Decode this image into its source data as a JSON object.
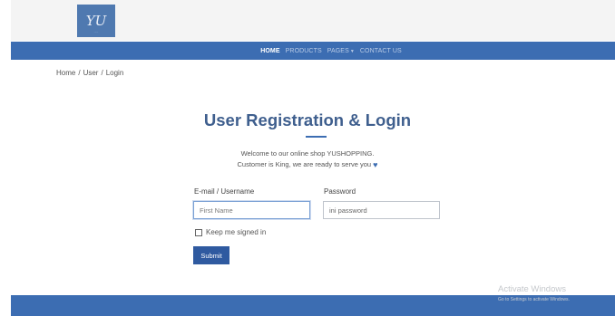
{
  "header": {
    "logo_text": "YU"
  },
  "nav": {
    "items": [
      {
        "label": "HOME",
        "active": true
      },
      {
        "label": "PRODUCTS",
        "active": false
      },
      {
        "label": "PAGES",
        "active": false,
        "dropdown": true
      },
      {
        "label": "CONTACT US",
        "active": false
      }
    ]
  },
  "breadcrumb": [
    "Home",
    "User",
    "Login"
  ],
  "page": {
    "title": "User Registration & Login",
    "welcome_line1": "Welcome to our online shop YUSHOPPING.",
    "welcome_line2": "Customer is King, we are ready to serve you",
    "heart_icon": "heart-icon"
  },
  "form": {
    "email_label": "E-mail / Username",
    "email_placeholder": "First Name",
    "password_label": "Password",
    "password_value": "ini password",
    "keep_signed_in": "Keep me signed in",
    "submit": "Submit"
  },
  "watermark": {
    "title": "Activate Windows",
    "subtitle": "Go to Settings to activate Windows."
  },
  "colors": {
    "brand": "#3c6db2",
    "title": "#3f5f8e",
    "button": "#2f5aa0"
  }
}
